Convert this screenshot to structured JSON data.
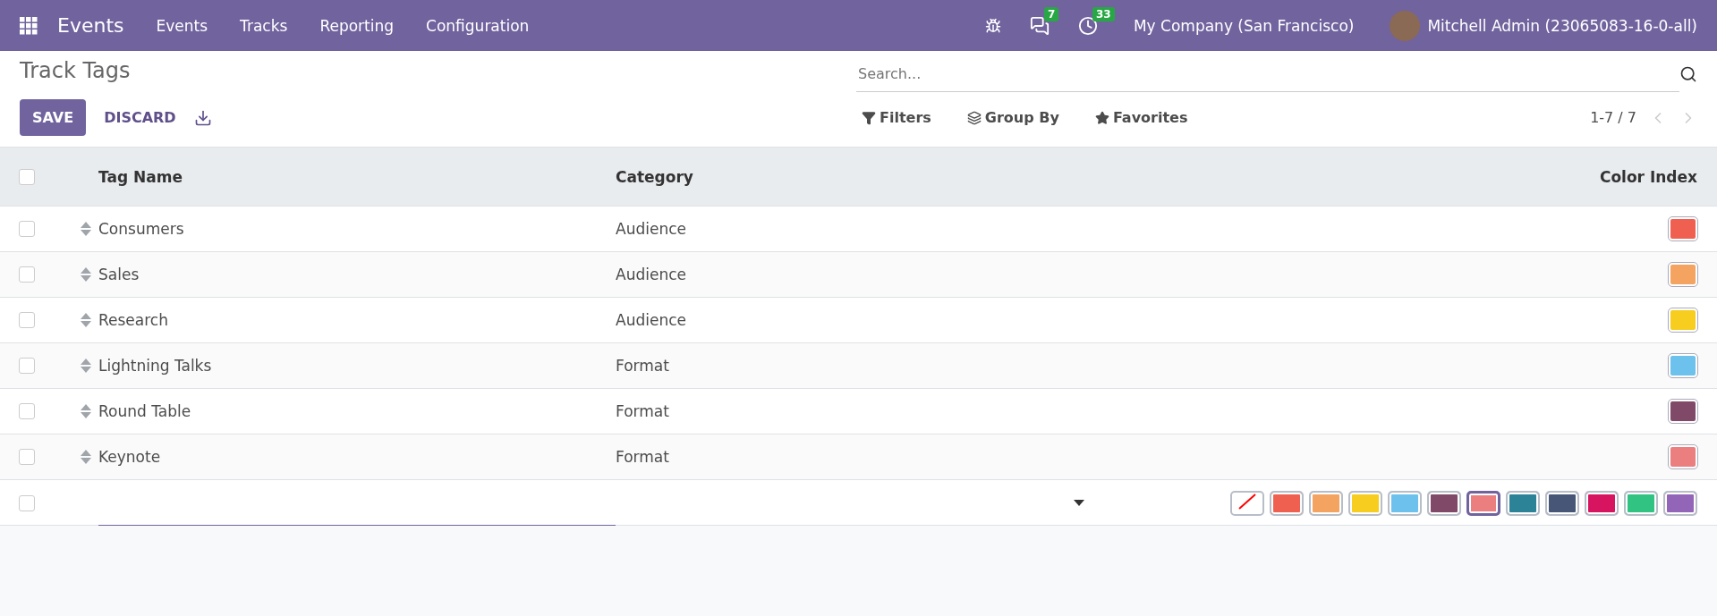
{
  "navbar": {
    "app_name": "Events",
    "menu": [
      "Events",
      "Tracks",
      "Reporting",
      "Configuration"
    ],
    "messages_count": "7",
    "activities_count": "33",
    "company": "My Company (San Francisco)",
    "user": "Mitchell Admin (23065083-16-0-all)"
  },
  "title": "Track Tags",
  "buttons": {
    "save": "SAVE",
    "discard": "DISCARD"
  },
  "search": {
    "placeholder": "Search..."
  },
  "filters": [
    "Filters",
    "Group By",
    "Favorites"
  ],
  "pager": "1-7 / 7",
  "table": {
    "select_all_checked": false,
    "columns": [
      "Tag Name",
      "Category",
      "Color Index"
    ],
    "rows": [
      {
        "checked": false,
        "name": "Consumers",
        "category": "Audience",
        "color": "#f06050"
      },
      {
        "checked": false,
        "name": "Sales",
        "category": "Audience",
        "color": "#f4a460"
      },
      {
        "checked": false,
        "name": "Research",
        "category": "Audience",
        "color": "#f7cd1f"
      },
      {
        "checked": false,
        "name": "Lightning Talks",
        "category": "Format",
        "color": "#6cc1ed"
      },
      {
        "checked": false,
        "name": "Round Table",
        "category": "Format",
        "color": "#814968"
      },
      {
        "checked": false,
        "name": "Keynote",
        "category": "Format",
        "color": "#eb7e7f"
      }
    ],
    "edit_row": {
      "checked": false,
      "palette": [
        {
          "kind": "none",
          "selected": false
        },
        {
          "kind": "color",
          "color": "#f06050",
          "selected": false
        },
        {
          "kind": "color",
          "color": "#f4a460",
          "selected": false
        },
        {
          "kind": "color",
          "color": "#f7cd1f",
          "selected": false
        },
        {
          "kind": "color",
          "color": "#6cc1ed",
          "selected": false
        },
        {
          "kind": "color",
          "color": "#814968",
          "selected": false
        },
        {
          "kind": "color",
          "color": "#eb7e7f",
          "selected": true
        },
        {
          "kind": "color",
          "color": "#2c8397",
          "selected": false
        },
        {
          "kind": "color",
          "color": "#475577",
          "selected": false
        },
        {
          "kind": "color",
          "color": "#d6145f",
          "selected": false
        },
        {
          "kind": "color",
          "color": "#30c381",
          "selected": false
        },
        {
          "kind": "color",
          "color": "#9365b8",
          "selected": false
        }
      ]
    }
  }
}
